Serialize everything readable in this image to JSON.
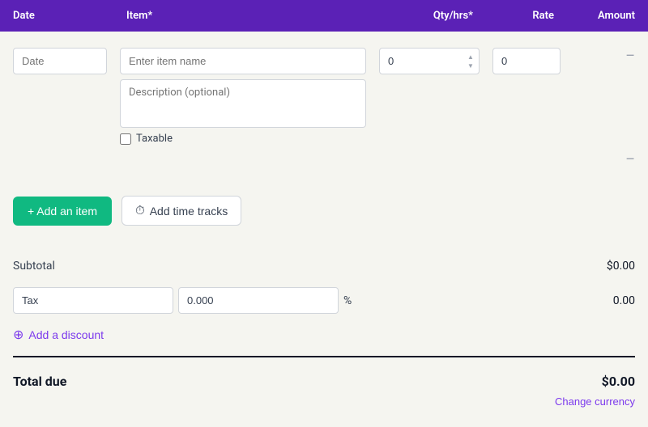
{
  "header": {
    "col_date": "Date",
    "col_item": "Item*",
    "col_qty": "Qty/hrs*",
    "col_rate": "Rate",
    "col_amount": "Amount"
  },
  "row": {
    "date_placeholder": "Date",
    "item_placeholder": "Enter item name",
    "description_placeholder": "Description (optional)",
    "qty_value": "0",
    "rate_value": "0",
    "taxable_label": "Taxable"
  },
  "actions": {
    "add_item": "+ Add an item",
    "add_tracks": "Add time tracks"
  },
  "totals": {
    "subtotal_label": "Subtotal",
    "subtotal_value": "$0.00",
    "tax_label_placeholder": "Tax",
    "tax_pct_value": "0.000",
    "tax_pct_symbol": "%",
    "tax_value": "0.00",
    "add_discount": "Add a discount",
    "total_due_label": "Total due",
    "total_due_value": "$0.00",
    "change_currency": "Change currency"
  }
}
